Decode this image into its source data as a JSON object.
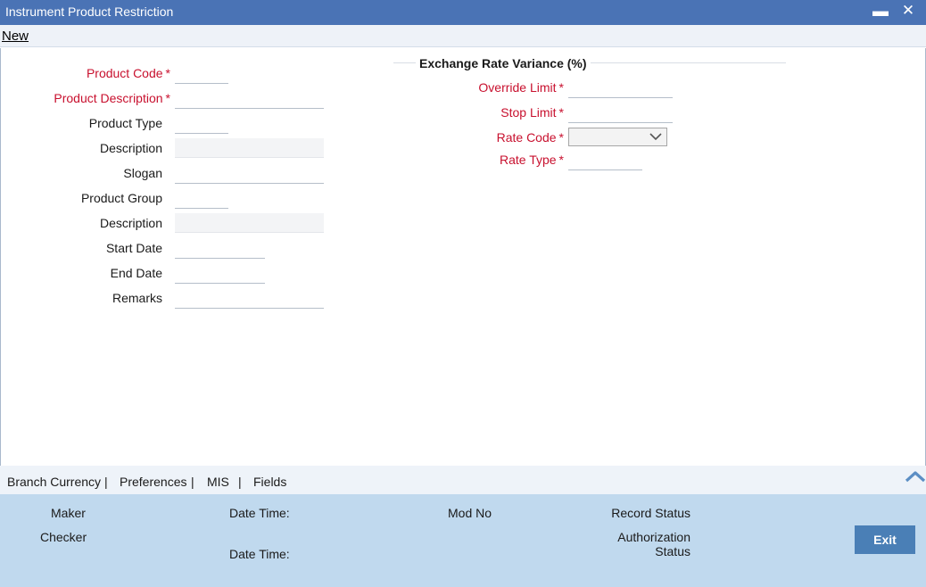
{
  "window": {
    "title": "Instrument Product Restriction",
    "minimize_glyph": "▬",
    "close_glyph": "✕"
  },
  "toolbar": {
    "new_label": "New"
  },
  "form": {
    "required_mark": "*",
    "left": [
      {
        "label": "Product Code",
        "required": true,
        "value": ""
      },
      {
        "label": "Product Description",
        "required": true,
        "value": ""
      },
      {
        "label": "Product Type",
        "required": false,
        "value": ""
      },
      {
        "label": "Description",
        "required": false,
        "value": "",
        "readonly": true
      },
      {
        "label": "Slogan",
        "required": false,
        "value": ""
      },
      {
        "label": "Product Group",
        "required": false,
        "value": ""
      },
      {
        "label": "Description",
        "required": false,
        "value": "",
        "readonly": true
      },
      {
        "label": "Start Date",
        "required": false,
        "value": ""
      },
      {
        "label": "End Date",
        "required": false,
        "value": ""
      },
      {
        "label": "Remarks",
        "required": false,
        "value": ""
      }
    ],
    "exchange_section": {
      "title": "Exchange Rate Variance (%)",
      "override_limit_label": "Override Limit",
      "override_limit_value": "",
      "stop_limit_label": "Stop Limit",
      "stop_limit_value": "",
      "rate_code_label": "Rate Code",
      "rate_code_value": "",
      "rate_type_label": "Rate Type",
      "rate_type_value": ""
    }
  },
  "tabs": {
    "items": [
      "Branch Currency",
      "Preferences",
      "MIS",
      "Fields"
    ],
    "separator": "|"
  },
  "footer": {
    "maker_label": "Maker",
    "checker_label": "Checker",
    "date_time_label_1": "Date Time:",
    "date_time_label_2": "Date Time:",
    "mod_no_label": "Mod No",
    "record_status_label": "Record Status",
    "authorization_label": "Authorization",
    "status_label": "Status",
    "exit_label": "Exit"
  },
  "colors": {
    "titlebar": "#4a73b5",
    "required_text": "#c8102e",
    "footer_bg": "#c0d9ee",
    "exit_button": "#4a7fb6"
  }
}
